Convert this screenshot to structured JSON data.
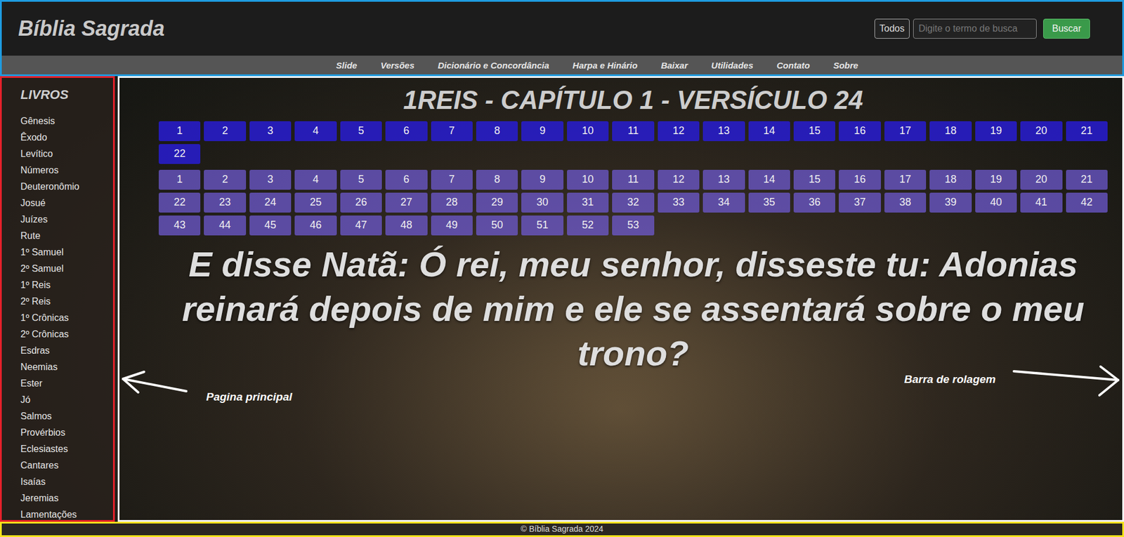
{
  "header": {
    "title": "Bíblia Sagrada",
    "filter_button": "Todos",
    "search_placeholder": "Digite o termo de busca",
    "search_button": "Buscar"
  },
  "nav": [
    "Slide",
    "Versões",
    "Dicionário e Concordância",
    "Harpa e Hinário",
    "Baixar",
    "Utilidades",
    "Contato",
    "Sobre"
  ],
  "sidebar": {
    "title": "LIVROS",
    "items": [
      "Gênesis",
      "Êxodo",
      "Levítico",
      "Números",
      "Deuteronômio",
      "Josué",
      "Juízes",
      "Rute",
      "1º Samuel",
      "2º Samuel",
      "1º Reis",
      "2º Reis",
      "1º Crônicas",
      "2º Crônicas",
      "Esdras",
      "Neemias",
      "Ester",
      "Jó",
      "Salmos",
      "Provérbios",
      "Eclesiastes",
      "Cantares",
      "Isaías",
      "Jeremias",
      "Lamentações"
    ]
  },
  "main": {
    "heading": "1REIS - CAPÍTULO 1 - VERSÍCULO 24",
    "chapters": [
      "1",
      "2",
      "3",
      "4",
      "5",
      "6",
      "7",
      "8",
      "9",
      "10",
      "11",
      "12",
      "13",
      "14",
      "15",
      "16",
      "17",
      "18",
      "19",
      "20",
      "21",
      "22"
    ],
    "verses": [
      "1",
      "2",
      "3",
      "4",
      "5",
      "6",
      "7",
      "8",
      "9",
      "10",
      "11",
      "12",
      "13",
      "14",
      "15",
      "16",
      "17",
      "18",
      "19",
      "20",
      "21",
      "22",
      "23",
      "24",
      "25",
      "26",
      "27",
      "28",
      "29",
      "30",
      "31",
      "32",
      "33",
      "34",
      "35",
      "36",
      "37",
      "38",
      "39",
      "40",
      "41",
      "42",
      "43",
      "44",
      "45",
      "46",
      "47",
      "48",
      "49",
      "50",
      "51",
      "52",
      "53"
    ],
    "verse_text": "E disse Natã: Ó rei, meu senhor, disseste tu: Adonias reinará depois de mim e ele se assentará sobre o meu trono?"
  },
  "annotations": [
    {
      "label": "Pagina principal",
      "kind": "left"
    },
    {
      "label": "Barra de rolagem",
      "kind": "right"
    }
  ],
  "footer": "© Bíblia Sagrada 2024"
}
